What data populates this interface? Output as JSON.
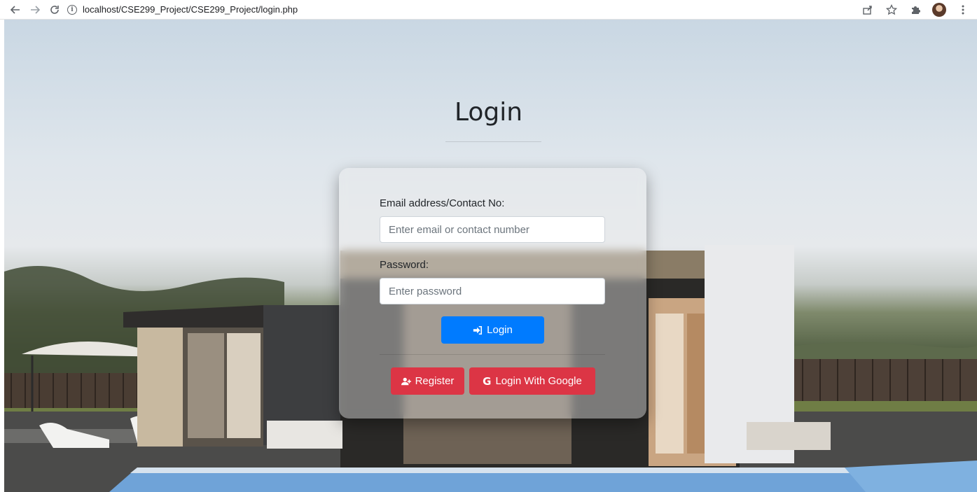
{
  "browser": {
    "url": "localhost/CSE299_Project/CSE299_Project/login.php",
    "back_icon": "arrow-left-icon",
    "forward_icon": "arrow-right-icon",
    "reload_icon": "reload-icon",
    "info_icon": "info-icon",
    "info_glyph": "i",
    "share_icon": "share-icon",
    "bookmark_icon": "star-icon",
    "extensions_icon": "puzzle-icon",
    "menu_icon": "kebab-menu-icon"
  },
  "login": {
    "title": "Login",
    "email_label": "Email address/Contact No:",
    "email_placeholder": "Enter email or contact number",
    "email_value": "",
    "password_label": "Password:",
    "password_placeholder": "Enter password",
    "password_value": "",
    "login_button": "Login",
    "register_button": "Register",
    "google_button": "Login With Google",
    "google_glyph": "G"
  },
  "colors": {
    "primary": "#007bff",
    "danger": "#dc3545"
  }
}
